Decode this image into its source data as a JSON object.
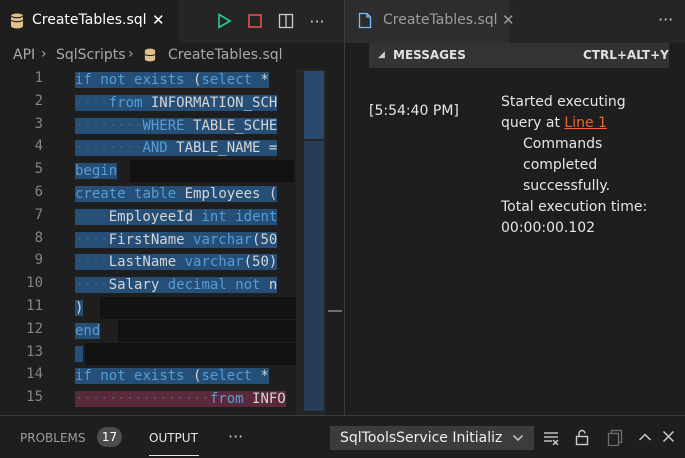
{
  "editor_left": {
    "tab": {
      "title": "CreateTables.sql",
      "close": "✕",
      "icon": "database-file-icon"
    },
    "actions": [
      {
        "name": "run-query-button",
        "glyph": "▷",
        "color": "#23d18b"
      },
      {
        "name": "stop-query-button",
        "glyph": "□",
        "color": "#f14c4c"
      },
      {
        "name": "split-editor-button",
        "glyph": "◫",
        "color": "#cccccc"
      },
      {
        "name": "more-actions-button",
        "glyph": "···",
        "color": "#cccccc"
      }
    ],
    "breadcrumb": {
      "part1": "API",
      "sep": "›",
      "part2": "SqlScripts",
      "part3": "CreateTables.sql"
    },
    "lines": [
      {
        "num": "1",
        "text": "if not exists (select *"
      },
      {
        "num": "2",
        "text": "····from INFORMATION_SCH"
      },
      {
        "num": "3",
        "text": "········WHERE TABLE_SCHE"
      },
      {
        "num": "4",
        "text": "········AND TABLE_NAME ="
      },
      {
        "num": "5",
        "text": "begin"
      },
      {
        "num": "6",
        "text": "create table Employees ("
      },
      {
        "num": "7",
        "text": "····EmployeeId int ident"
      },
      {
        "num": "8",
        "text": "····FirstName varchar(50"
      },
      {
        "num": "9",
        "text": "····LastName varchar(50)"
      },
      {
        "num": "10",
        "text": "····Salary decimal not n"
      },
      {
        "num": "11",
        "text": ")"
      },
      {
        "num": "12",
        "text": "end"
      },
      {
        "num": "13",
        "text": ""
      },
      {
        "num": "14",
        "text": "if not exists (select *"
      },
      {
        "num": "15",
        "text": "················from INFO"
      }
    ]
  },
  "editor_right": {
    "tab": {
      "title": "CreateTables.sql",
      "close": "✕"
    },
    "more": "···",
    "messages_header": {
      "label": "MESSAGES",
      "shortcut": "CTRL+ALT+Y"
    },
    "message": {
      "time": "[5:54:40 PM]",
      "line1": "Started executing",
      "line2_prefix": "query at ",
      "link": "Line 1",
      "detail1": "Commands",
      "detail2": "completed",
      "detail3": "successfully.",
      "total1": "Total execution time:",
      "total2": "00:00:00.102"
    }
  },
  "panel": {
    "problems": "PROBLEMS",
    "problems_count": "17",
    "output": "OUTPUT",
    "more": "···",
    "channel": "SqlToolsService Initializ"
  },
  "colors": {
    "accent": "#569cd6",
    "selection": "#264f78",
    "link": "#f0652f"
  }
}
